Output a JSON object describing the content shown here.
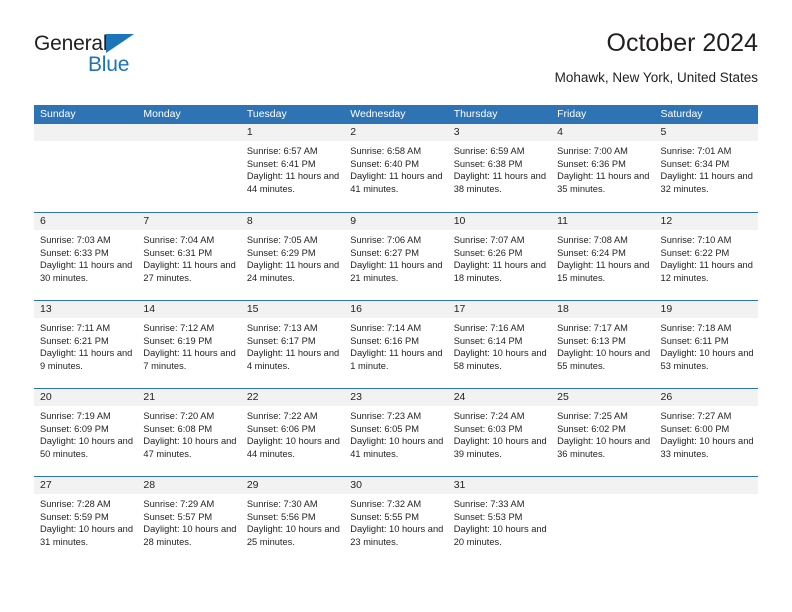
{
  "logo": {
    "text_primary": "General",
    "text_secondary": "Blue",
    "primary_color": "#231f20",
    "accent_color": "#1b75bb",
    "triangle_icon": "triangle-icon"
  },
  "header": {
    "title": "October 2024",
    "subtitle": "Mohawk, New York, United States"
  },
  "theme": {
    "header_bg": "#2e74b5",
    "header_text": "#ffffff",
    "daynum_bg": "#f2f2f2",
    "body_text": "#231f20",
    "week_divider": "#2e74b5"
  },
  "weekdays": [
    "Sunday",
    "Monday",
    "Tuesday",
    "Wednesday",
    "Thursday",
    "Friday",
    "Saturday"
  ],
  "labels": {
    "sunrise": "Sunrise:",
    "sunset": "Sunset:",
    "daylight": "Daylight:"
  },
  "weeks": [
    [
      {
        "day": "",
        "sunrise": "",
        "sunset": "",
        "daylight": "",
        "empty": true
      },
      {
        "day": "",
        "sunrise": "",
        "sunset": "",
        "daylight": "",
        "empty": true
      },
      {
        "day": "1",
        "sunrise": "Sunrise: 6:57 AM",
        "sunset": "Sunset: 6:41 PM",
        "daylight": "Daylight: 11 hours and 44 minutes."
      },
      {
        "day": "2",
        "sunrise": "Sunrise: 6:58 AM",
        "sunset": "Sunset: 6:40 PM",
        "daylight": "Daylight: 11 hours and 41 minutes."
      },
      {
        "day": "3",
        "sunrise": "Sunrise: 6:59 AM",
        "sunset": "Sunset: 6:38 PM",
        "daylight": "Daylight: 11 hours and 38 minutes."
      },
      {
        "day": "4",
        "sunrise": "Sunrise: 7:00 AM",
        "sunset": "Sunset: 6:36 PM",
        "daylight": "Daylight: 11 hours and 35 minutes."
      },
      {
        "day": "5",
        "sunrise": "Sunrise: 7:01 AM",
        "sunset": "Sunset: 6:34 PM",
        "daylight": "Daylight: 11 hours and 32 minutes."
      }
    ],
    [
      {
        "day": "6",
        "sunrise": "Sunrise: 7:03 AM",
        "sunset": "Sunset: 6:33 PM",
        "daylight": "Daylight: 11 hours and 30 minutes."
      },
      {
        "day": "7",
        "sunrise": "Sunrise: 7:04 AM",
        "sunset": "Sunset: 6:31 PM",
        "daylight": "Daylight: 11 hours and 27 minutes."
      },
      {
        "day": "8",
        "sunrise": "Sunrise: 7:05 AM",
        "sunset": "Sunset: 6:29 PM",
        "daylight": "Daylight: 11 hours and 24 minutes."
      },
      {
        "day": "9",
        "sunrise": "Sunrise: 7:06 AM",
        "sunset": "Sunset: 6:27 PM",
        "daylight": "Daylight: 11 hours and 21 minutes."
      },
      {
        "day": "10",
        "sunrise": "Sunrise: 7:07 AM",
        "sunset": "Sunset: 6:26 PM",
        "daylight": "Daylight: 11 hours and 18 minutes."
      },
      {
        "day": "11",
        "sunrise": "Sunrise: 7:08 AM",
        "sunset": "Sunset: 6:24 PM",
        "daylight": "Daylight: 11 hours and 15 minutes."
      },
      {
        "day": "12",
        "sunrise": "Sunrise: 7:10 AM",
        "sunset": "Sunset: 6:22 PM",
        "daylight": "Daylight: 11 hours and 12 minutes."
      }
    ],
    [
      {
        "day": "13",
        "sunrise": "Sunrise: 7:11 AM",
        "sunset": "Sunset: 6:21 PM",
        "daylight": "Daylight: 11 hours and 9 minutes."
      },
      {
        "day": "14",
        "sunrise": "Sunrise: 7:12 AM",
        "sunset": "Sunset: 6:19 PM",
        "daylight": "Daylight: 11 hours and 7 minutes."
      },
      {
        "day": "15",
        "sunrise": "Sunrise: 7:13 AM",
        "sunset": "Sunset: 6:17 PM",
        "daylight": "Daylight: 11 hours and 4 minutes."
      },
      {
        "day": "16",
        "sunrise": "Sunrise: 7:14 AM",
        "sunset": "Sunset: 6:16 PM",
        "daylight": "Daylight: 11 hours and 1 minute."
      },
      {
        "day": "17",
        "sunrise": "Sunrise: 7:16 AM",
        "sunset": "Sunset: 6:14 PM",
        "daylight": "Daylight: 10 hours and 58 minutes."
      },
      {
        "day": "18",
        "sunrise": "Sunrise: 7:17 AM",
        "sunset": "Sunset: 6:13 PM",
        "daylight": "Daylight: 10 hours and 55 minutes."
      },
      {
        "day": "19",
        "sunrise": "Sunrise: 7:18 AM",
        "sunset": "Sunset: 6:11 PM",
        "daylight": "Daylight: 10 hours and 53 minutes."
      }
    ],
    [
      {
        "day": "20",
        "sunrise": "Sunrise: 7:19 AM",
        "sunset": "Sunset: 6:09 PM",
        "daylight": "Daylight: 10 hours and 50 minutes."
      },
      {
        "day": "21",
        "sunrise": "Sunrise: 7:20 AM",
        "sunset": "Sunset: 6:08 PM",
        "daylight": "Daylight: 10 hours and 47 minutes."
      },
      {
        "day": "22",
        "sunrise": "Sunrise: 7:22 AM",
        "sunset": "Sunset: 6:06 PM",
        "daylight": "Daylight: 10 hours and 44 minutes."
      },
      {
        "day": "23",
        "sunrise": "Sunrise: 7:23 AM",
        "sunset": "Sunset: 6:05 PM",
        "daylight": "Daylight: 10 hours and 41 minutes."
      },
      {
        "day": "24",
        "sunrise": "Sunrise: 7:24 AM",
        "sunset": "Sunset: 6:03 PM",
        "daylight": "Daylight: 10 hours and 39 minutes."
      },
      {
        "day": "25",
        "sunrise": "Sunrise: 7:25 AM",
        "sunset": "Sunset: 6:02 PM",
        "daylight": "Daylight: 10 hours and 36 minutes."
      },
      {
        "day": "26",
        "sunrise": "Sunrise: 7:27 AM",
        "sunset": "Sunset: 6:00 PM",
        "daylight": "Daylight: 10 hours and 33 minutes."
      }
    ],
    [
      {
        "day": "27",
        "sunrise": "Sunrise: 7:28 AM",
        "sunset": "Sunset: 5:59 PM",
        "daylight": "Daylight: 10 hours and 31 minutes."
      },
      {
        "day": "28",
        "sunrise": "Sunrise: 7:29 AM",
        "sunset": "Sunset: 5:57 PM",
        "daylight": "Daylight: 10 hours and 28 minutes."
      },
      {
        "day": "29",
        "sunrise": "Sunrise: 7:30 AM",
        "sunset": "Sunset: 5:56 PM",
        "daylight": "Daylight: 10 hours and 25 minutes."
      },
      {
        "day": "30",
        "sunrise": "Sunrise: 7:32 AM",
        "sunset": "Sunset: 5:55 PM",
        "daylight": "Daylight: 10 hours and 23 minutes."
      },
      {
        "day": "31",
        "sunrise": "Sunrise: 7:33 AM",
        "sunset": "Sunset: 5:53 PM",
        "daylight": "Daylight: 10 hours and 20 minutes."
      },
      {
        "day": "",
        "sunrise": "",
        "sunset": "",
        "daylight": "",
        "empty": true
      },
      {
        "day": "",
        "sunrise": "",
        "sunset": "",
        "daylight": "",
        "empty": true
      }
    ]
  ]
}
